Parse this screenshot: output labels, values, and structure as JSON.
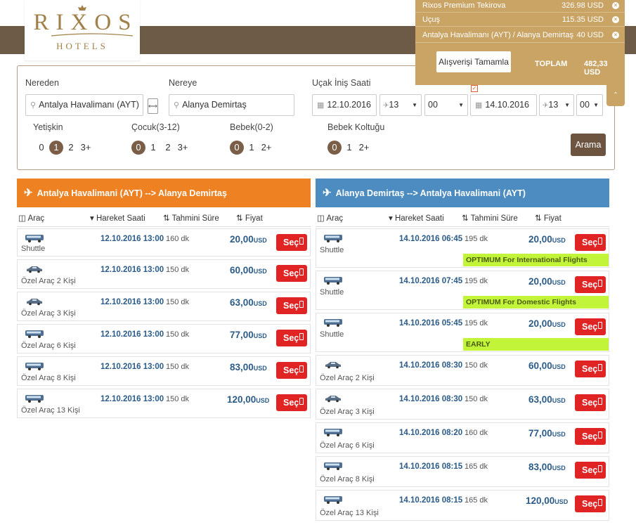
{
  "brand": {
    "name": "RIXOS",
    "sub": "HOTELS"
  },
  "cart": {
    "items": [
      {
        "label": "Rixos Premium Tekirova",
        "value": "326.98 USD"
      },
      {
        "label": "Uçuş",
        "value": "115.35 USD"
      },
      {
        "label": "Antalya Havalimanı (AYT) / Alanya Demirtaş",
        "value": "40 USD"
      }
    ],
    "complete_label": "Alışverişi Tamamla",
    "total_label": "TOPLAM",
    "total_value": "482,33 USD"
  },
  "search": {
    "from_label": "Nereden",
    "from_value": "Antalya Havalimanı (AYT)",
    "to_label": "Nereye",
    "to_value": "Alanya Demirtaş",
    "landing_label": "Uçak İniş Saati",
    "landing_date": "12.10.2016",
    "landing_hour": "13",
    "landing_min": "00",
    "return_date": "14.10.2016",
    "return_hour": "13",
    "return_min": "00",
    "adult_label": "Yetişkin",
    "adult_opts": [
      "0",
      "1",
      "2",
      "3+"
    ],
    "child_label": "Çocuk(3-12)",
    "child_opts": [
      "0",
      "1",
      "2",
      "3+"
    ],
    "baby_label": "Bebek(0-2)",
    "baby_opts": [
      "0",
      "1",
      "2+"
    ],
    "seat_label": "Bebek Koltuğu",
    "seat_opts": [
      "0",
      "1",
      "2+"
    ],
    "search_button": "Arama"
  },
  "columns": {
    "vehicle": "Araç",
    "departure": "Hareket Saati",
    "duration": "Tahmini Süre",
    "price": "Fiyat"
  },
  "select_label": "Seç",
  "currency": "USD",
  "outbound": {
    "title": "Antalya Havalimani (AYT) --> Alanya Demirtaş",
    "color": "#ee8122",
    "rows": [
      {
        "vehicle": "Shuttle",
        "time": "12.10.2016 13:00",
        "duration": "160 dk",
        "price": "20,00"
      },
      {
        "vehicle": "Özel Araç 2 Kişi",
        "time": "12.10.2016 13:00",
        "duration": "150 dk",
        "price": "60,00"
      },
      {
        "vehicle": "Özel Araç 3 Kişi",
        "time": "12.10.2016 13:00",
        "duration": "150 dk",
        "price": "63,00"
      },
      {
        "vehicle": "Özel Araç 6 Kişi",
        "time": "12.10.2016 13:00",
        "duration": "150 dk",
        "price": "77,00"
      },
      {
        "vehicle": "Özel Araç 8 Kişi",
        "time": "12.10.2016 13:00",
        "duration": "150 dk",
        "price": "83,00"
      },
      {
        "vehicle": "Özel Araç 13 Kişi",
        "time": "12.10.2016 13:00",
        "duration": "150 dk",
        "price": "120,00"
      }
    ]
  },
  "return": {
    "title": "Alanya Demirtaş --> Antalya Havalimani (AYT)",
    "color": "#4d8cc0",
    "rows": [
      {
        "vehicle": "Shuttle",
        "time": "14.10.2016 06:45",
        "duration": "195 dk",
        "price": "20,00",
        "tag": "OPTIMUM For International Flights"
      },
      {
        "vehicle": "Shuttle",
        "time": "14.10.2016 07:45",
        "duration": "195 dk",
        "price": "20,00",
        "tag": "OPTIMUM For Domestic Flights"
      },
      {
        "vehicle": "Shuttle",
        "time": "14.10.2016 05:45",
        "duration": "195 dk",
        "price": "20,00",
        "tag": "EARLY"
      },
      {
        "vehicle": "Özel Araç 2 Kişi",
        "time": "14.10.2016 08:30",
        "duration": "150 dk",
        "price": "60,00"
      },
      {
        "vehicle": "Özel Araç 3 Kişi",
        "time": "14.10.2016 08:30",
        "duration": "150 dk",
        "price": "63,00"
      },
      {
        "vehicle": "Özel Araç 6 Kişi",
        "time": "14.10.2016 08:20",
        "duration": "160 dk",
        "price": "77,00"
      },
      {
        "vehicle": "Özel Araç 8 Kişi",
        "time": "14.10.2016 08:15",
        "duration": "165 dk",
        "price": "83,00"
      },
      {
        "vehicle": "Özel Araç 13 Kişi",
        "time": "14.10.2016 08:15",
        "duration": "165 dk",
        "price": "120,00"
      }
    ]
  }
}
